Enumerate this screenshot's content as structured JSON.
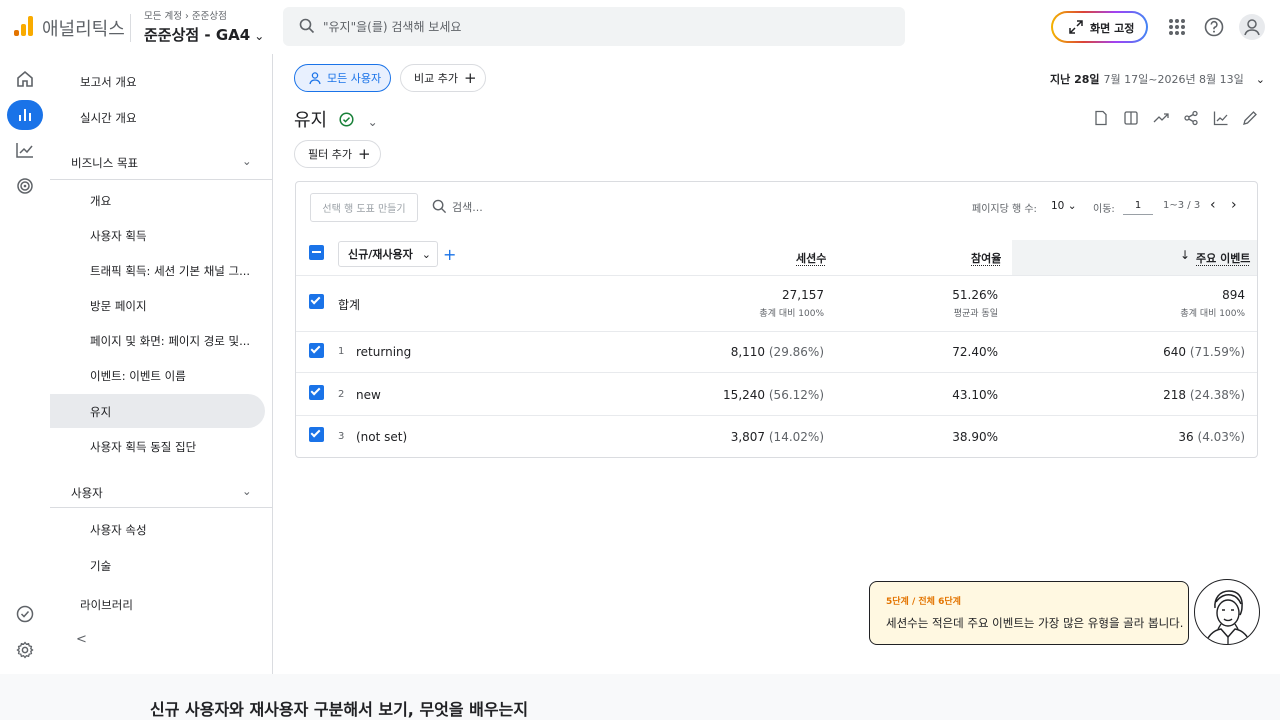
{
  "header": {
    "logo_text": "애널리틱스",
    "breadcrumb": [
      "모든 계정",
      "준준상점"
    ],
    "property": "준준상점 - GA4",
    "search_placeholder": "\"유지\"을(를) 검색해 보세요",
    "fix_screen_label": "화면 고정"
  },
  "sidebar": {
    "items": [
      {
        "label": "보고서 개요"
      },
      {
        "label": "실시간 개요"
      }
    ],
    "sections": [
      {
        "label": "비즈니스 목표",
        "items": [
          "개요",
          "사용자 획득",
          "트래픽 획득: 세션 기본 채널 그...",
          "방문 페이지",
          "페이지 및 화면: 페이지 경로 및...",
          "이벤트: 이벤트 이름",
          "유지",
          "사용자 획득 동질 집단"
        ]
      },
      {
        "label": "사용자",
        "items": [
          "사용자 속성",
          "기술"
        ]
      }
    ],
    "library": "라이브러리",
    "collapse": "<"
  },
  "main": {
    "segment_label": "모든 사용자",
    "compare_label": "비교 추가",
    "date_prefix": "지난 28일",
    "date_range": "7월 17일~2026년 8월 13일",
    "title": "유지",
    "filter_label": "필터 추가"
  },
  "table": {
    "chart_btn": "선택 행 도표 만들기",
    "search_placeholder": "검색...",
    "rows_per_page_label": "페이지당 행 수:",
    "rows_per_page": "10",
    "goto_label": "이동:",
    "goto_value": "1",
    "range": "1~3 / 3",
    "dimension": "신규/재사용자",
    "columns": [
      "세션수",
      "참여율",
      "주요 이벤트"
    ],
    "total": {
      "label": "합계",
      "sessions": "27,157",
      "sessions_sub": "총계 대비 100%",
      "engagement": "51.26%",
      "engagement_sub": "평균과 동일",
      "events": "894",
      "events_sub": "총계 대비 100%"
    },
    "rows": [
      {
        "idx": "1",
        "name": "returning",
        "sessions": "8,110",
        "sessions_pct": "(29.86%)",
        "engagement": "72.40%",
        "events": "640",
        "events_pct": "(71.59%)"
      },
      {
        "idx": "2",
        "name": "new",
        "sessions": "15,240",
        "sessions_pct": "(56.12%)",
        "engagement": "43.10%",
        "events": "218",
        "events_pct": "(24.38%)"
      },
      {
        "idx": "3",
        "name": "(not set)",
        "sessions": "3,807",
        "sessions_pct": "(14.02%)",
        "engagement": "38.90%",
        "events": "36",
        "events_pct": "(4.03%)"
      }
    ]
  },
  "tooltip": {
    "step": "5단계 / 전체 6단계",
    "text": "세션수는 적은데 주요 이벤트는 가장 많은 유형을 골라 봅니다."
  },
  "bottom_title": "신규 사용자와 재사용자 구분해서 보기, 무엇을 배우는지",
  "colors": {
    "accent": "#1a73e8",
    "logo_orange": "#f9ab00",
    "logo_dark": "#e37400",
    "tooltip_bg": "#fff8e1"
  }
}
